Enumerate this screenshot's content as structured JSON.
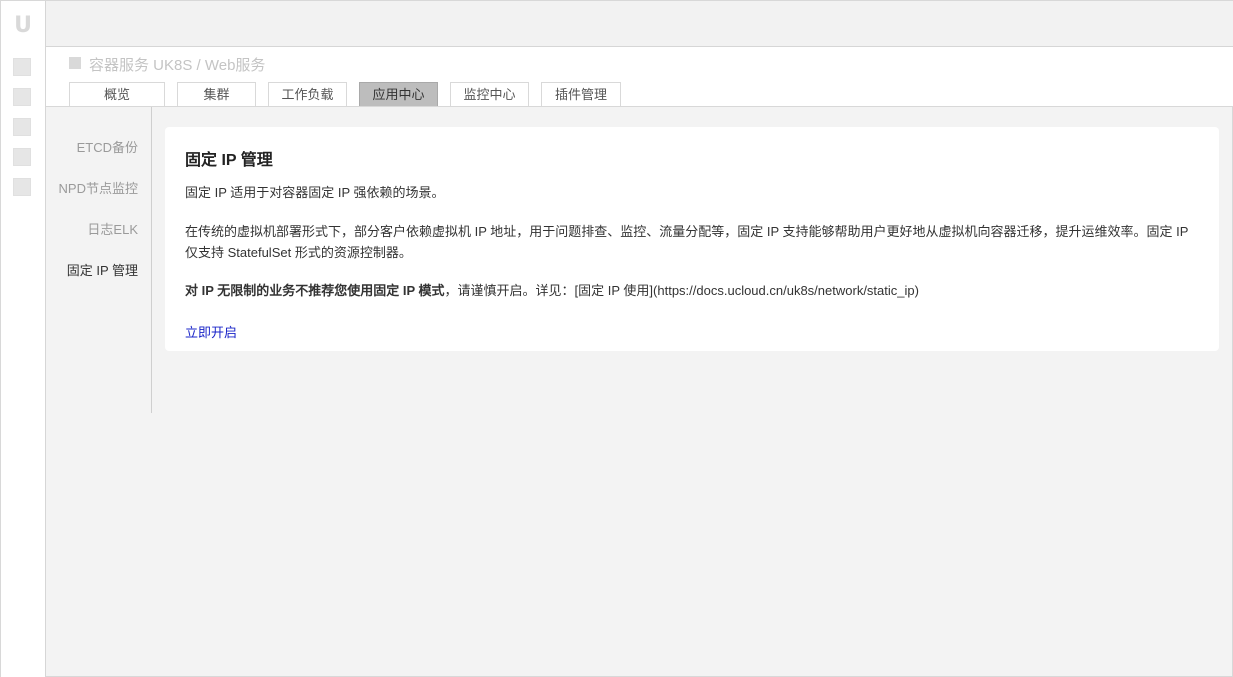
{
  "rail": {
    "logo": "U",
    "icons": [
      "menu-item-icon-1",
      "menu-item-icon-2",
      "menu-item-icon-3",
      "menu-item-icon-4",
      "menu-item-icon-5"
    ]
  },
  "breadcrumb": "容器服务 UK8S / Web服务",
  "tabs": [
    {
      "label": "概览"
    },
    {
      "label": "集群"
    },
    {
      "label": "工作负载"
    },
    {
      "label": "应用中心"
    },
    {
      "label": "监控中心"
    },
    {
      "label": "插件管理"
    }
  ],
  "active_tab": "应用中心",
  "sidenav": [
    {
      "label": "ETCD备份"
    },
    {
      "label": "NPD节点监控"
    },
    {
      "label": "日志ELK"
    },
    {
      "label": "固定 IP 管理"
    }
  ],
  "active_sidenav": "固定 IP 管理",
  "card": {
    "title": "固定 IP 管理",
    "p1": "固定 IP 适用于对容器固定 IP 强依赖的场景。",
    "p2": "在传统的虚拟机部署形式下，部分客户依赖虚拟机 IP 地址，用于问题排查、监控、流量分配等，固定 IP 支持能够帮助用户更好地从虚拟机向容器迁移，提升运维效率。固定 IP 仅支持 StatefulSet 形式的资源控制器。",
    "p3_bold": "对 IP 无限制的业务不推荐您使用固定 IP 模式",
    "p3_rest": "，请谨慎开启。详见：[固定 IP 使用](https://docs.ucloud.cn/uk8s/network/static_ip)",
    "enable_link": "立即开启"
  },
  "colors": {
    "active_tab_bg": "#bdbdbd",
    "link": "#1a24c8",
    "page_bg": "#f3f3f3"
  }
}
